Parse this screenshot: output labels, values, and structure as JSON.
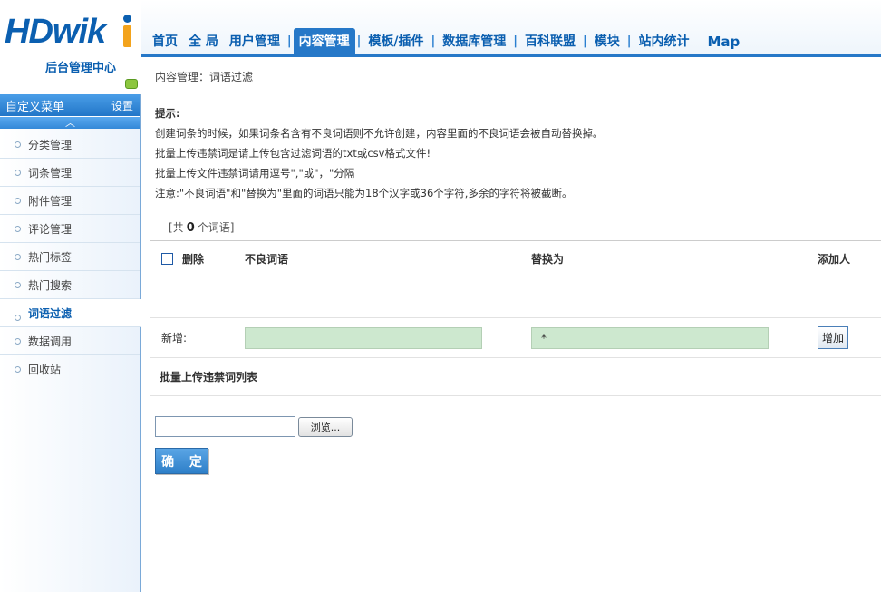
{
  "logo": {
    "brand": "HDwik",
    "subtitle": "后台管理中心"
  },
  "topnav": {
    "items": [
      "首页",
      "全 局",
      "用户管理",
      "内容管理",
      "模板/插件",
      "数据库管理",
      "百科联盟",
      "模块",
      "站内统计"
    ],
    "map": "Map",
    "active_index": 3,
    "separator": "|"
  },
  "sidebar": {
    "custom_menu": "自定义菜单",
    "settings": "设置",
    "collapse_glyph": "︿",
    "items": [
      "分类管理",
      "词条管理",
      "附件管理",
      "评论管理",
      "热门标签",
      "热门搜索",
      "词语过滤",
      "数据调用",
      "回收站"
    ],
    "active_index": 6
  },
  "main": {
    "breadcrumb": "内容管理：词语过滤",
    "tips": {
      "title": "提示:",
      "lines": [
        "创建词条的时候，如果词条名含有不良词语则不允许创建，内容里面的不良词语会被自动替换掉。",
        "批量上传违禁词是请上传包含过滤词语的txt或csv格式文件!",
        "批量上传文件违禁词请用逗号\",\"或\"，\"分隔",
        "注意:\"不良词语\"和\"替换为\"里面的词语只能为18个汉字或36个字符,多余的字符将被截断。"
      ]
    },
    "word_count": {
      "prefix": "[共",
      "count": "0",
      "suffix": "个词语]"
    },
    "table": {
      "headers": {
        "delete": "删除",
        "bad_word": "不良词语",
        "replace": "替换为",
        "added_by": "添加人"
      },
      "add_row": {
        "label": "新增:",
        "bad_word_value": "",
        "replace_value": "*",
        "add_button": "增加"
      }
    },
    "batch": {
      "title": "批量上传违禁词列表",
      "browse": "浏览...",
      "confirm": "确 定"
    }
  }
}
